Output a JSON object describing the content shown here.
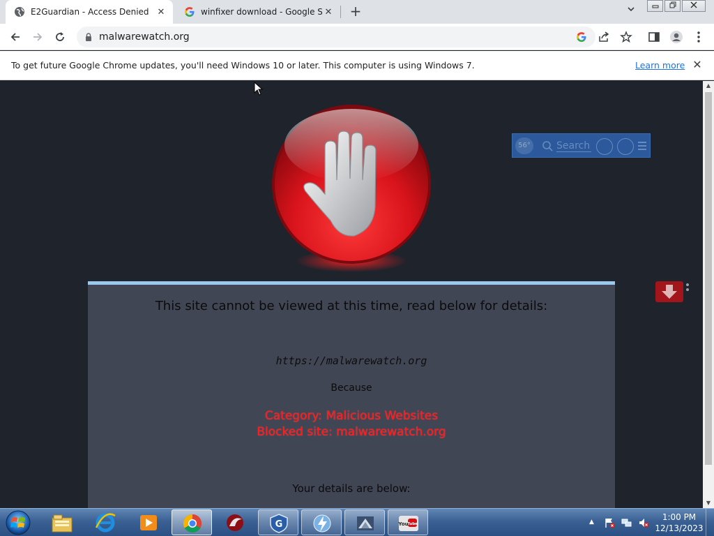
{
  "browser": {
    "tabs": [
      {
        "title": "E2Guardian - Access Denied",
        "active": true,
        "favicon": "globe-icon"
      },
      {
        "title": "winfixer download - Google Sear",
        "active": false,
        "favicon": "google-g-icon"
      }
    ],
    "new_tab_symbol": "+",
    "tab_close_symbol": "✕",
    "tab_list_symbol": "⌄",
    "window_controls": {
      "minimize": "▭",
      "restore": "⧉",
      "close": "✕"
    },
    "address": "malwarewatch.org",
    "infobar": {
      "message": "To get future Google Chrome updates, you'll need Windows 10 or later. This computer is using Windows 7.",
      "link": "Learn more",
      "close_symbol": "✕"
    }
  },
  "page": {
    "addon_toolbar": {
      "badge": "56°",
      "search_placeholder": "Search"
    },
    "heading": "This site cannot be viewed at this time, read below for details:",
    "blocked_url": "https://malwarewatch.org",
    "because_label": "Because",
    "reason_category": "Category: Malicious Websites",
    "reason_blocked": "Blocked site: malwarewatch.org",
    "details_heading": "Your details are below:"
  },
  "taskbar": {
    "items": [
      "windows-explorer",
      "internet-explorer",
      "media-player",
      "google-chrome",
      "comodo-dragon",
      "shield-app",
      "network-app",
      "writer-app",
      "youtube-app"
    ],
    "clock_time": "1:00 PM",
    "clock_date": "12/13/2023",
    "tray_arrow": "▲"
  },
  "colors": {
    "page_bg": "#1f232c",
    "panel_bg": "#414655",
    "panel_border": "#9cc7ef",
    "reason_text": "#ff1a1a",
    "stop_red": "#d0121b"
  }
}
